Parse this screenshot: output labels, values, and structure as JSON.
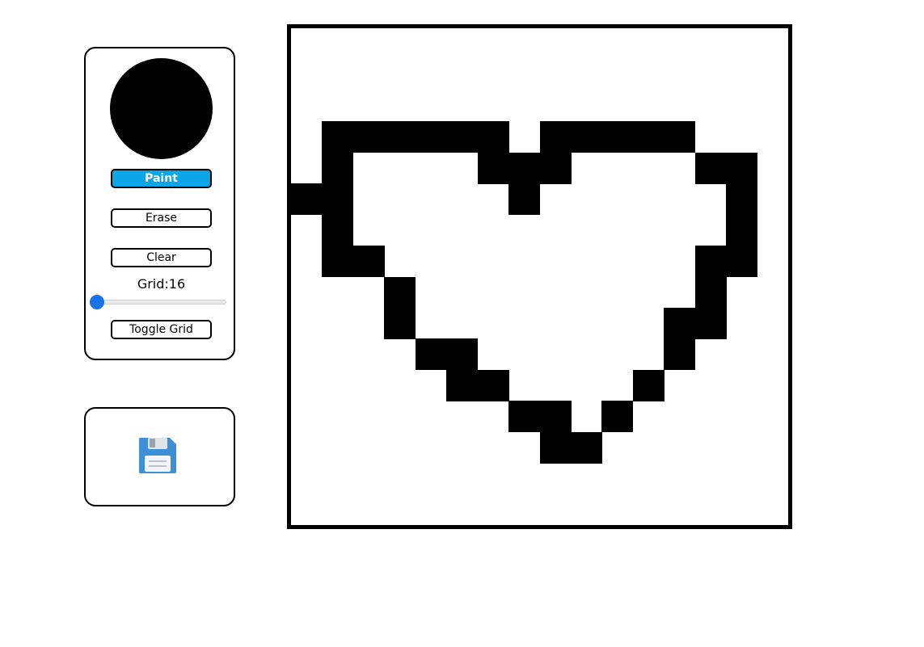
{
  "tools": {
    "current_color": "#000000",
    "buttons": {
      "paint": "Paint",
      "erase": "Erase",
      "clear": "Clear",
      "toggle_grid": "Toggle Grid"
    },
    "active_mode": "paint",
    "grid_label": "Grid:16",
    "grid_slider": {
      "value": 16,
      "min": 16,
      "max": 100
    },
    "accent_color": "#0aa6e9"
  },
  "save": {
    "icon": "floppy-disk-save-icon"
  },
  "canvas": {
    "grid_size": 16,
    "fill_color": "#000000",
    "filled_cells": [
      [
        1,
        3
      ],
      [
        2,
        3
      ],
      [
        3,
        3
      ],
      [
        4,
        3
      ],
      [
        5,
        3
      ],
      [
        6,
        3
      ],
      [
        8,
        3
      ],
      [
        9,
        3
      ],
      [
        10,
        3
      ],
      [
        11,
        3
      ],
      [
        12,
        3
      ],
      [
        1,
        4
      ],
      [
        6,
        4
      ],
      [
        7,
        4
      ],
      [
        8,
        4
      ],
      [
        13,
        4
      ],
      [
        14,
        4
      ],
      [
        0,
        5
      ],
      [
        1,
        5
      ],
      [
        7,
        5
      ],
      [
        14,
        5
      ],
      [
        1,
        6
      ],
      [
        14,
        6
      ],
      [
        1,
        7
      ],
      [
        2,
        7
      ],
      [
        13,
        7
      ],
      [
        14,
        7
      ],
      [
        3,
        8
      ],
      [
        13,
        8
      ],
      [
        3,
        9
      ],
      [
        12,
        9
      ],
      [
        13,
        9
      ],
      [
        4,
        10
      ],
      [
        5,
        10
      ],
      [
        12,
        10
      ],
      [
        5,
        11
      ],
      [
        6,
        11
      ],
      [
        11,
        11
      ],
      [
        7,
        12
      ],
      [
        8,
        12
      ],
      [
        10,
        12
      ],
      [
        8,
        13
      ],
      [
        9,
        13
      ]
    ]
  }
}
